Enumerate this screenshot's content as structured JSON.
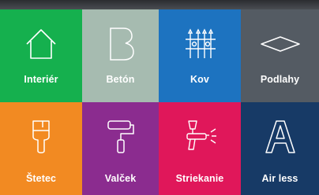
{
  "tiles": [
    {
      "label": "Interiér",
      "icon": "house-icon",
      "color": "#15b04e"
    },
    {
      "label": "Betón",
      "icon": "letter-b-icon",
      "color": "#a6bbb0"
    },
    {
      "label": "Kov",
      "icon": "fence-icon",
      "color": "#1d73c0"
    },
    {
      "label": "Podlahy",
      "icon": "floor-tile-icon",
      "color": "#545b63"
    },
    {
      "label": "Štetec",
      "icon": "brush-icon",
      "color": "#f28a22"
    },
    {
      "label": "Valček",
      "icon": "paint-roller-icon",
      "color": "#8b2c8f"
    },
    {
      "label": "Striekanie",
      "icon": "spray-gun-icon",
      "color": "#e0175a"
    },
    {
      "label": "Air less",
      "icon": "letter-a-icon",
      "color": "#173a66"
    }
  ]
}
